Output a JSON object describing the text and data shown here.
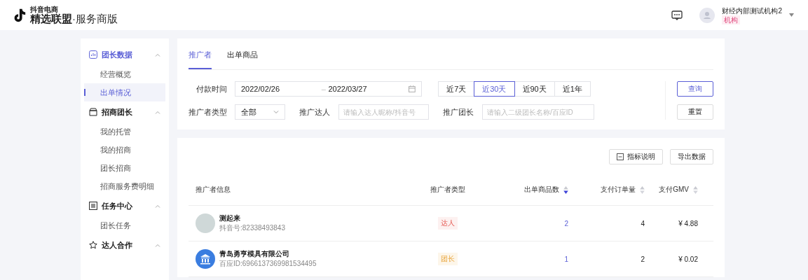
{
  "header": {
    "brand_small": "抖音电商",
    "brand_main": "精选联盟",
    "brand_sub": "·服务商版",
    "user_name": "财经内部测试机构2",
    "user_role": "机构"
  },
  "sidebar": {
    "groups": [
      {
        "title": "团长数据",
        "expanded": true,
        "selected": true,
        "children": [
          {
            "label": "经营概览",
            "selected": false
          },
          {
            "label": "出单情况",
            "selected": true
          }
        ]
      },
      {
        "title": "招商团长",
        "expanded": true,
        "selected": false,
        "children": [
          {
            "label": "我的托管",
            "selected": false
          },
          {
            "label": "我的招商",
            "selected": false
          },
          {
            "label": "团长招商",
            "selected": false
          },
          {
            "label": "招商服务费明细",
            "selected": false
          }
        ]
      },
      {
        "title": "任务中心",
        "expanded": true,
        "selected": false,
        "children": [
          {
            "label": "团长任务",
            "selected": false
          }
        ]
      },
      {
        "title": "达人合作",
        "expanded": true,
        "selected": false
      }
    ]
  },
  "tabs": [
    {
      "label": "推广者",
      "selected": true
    },
    {
      "label": "出单商品",
      "selected": false
    }
  ],
  "filters": {
    "date_label": "付款时间",
    "date_start": "2022/02/26",
    "date_sep": "–",
    "date_end": "2022/03/27",
    "ranges": [
      {
        "label": "近7天",
        "selected": false
      },
      {
        "label": "近30天",
        "selected": true
      },
      {
        "label": "近90天",
        "selected": false
      },
      {
        "label": "近1年",
        "selected": false
      }
    ],
    "type_label": "推广者类型",
    "type_value": "全部",
    "talent_label": "推广达人",
    "talent_placeholder": "请输入达人昵称/抖音号",
    "leader_label": "推广团长",
    "leader_placeholder": "请输入二级团长名称/百应ID",
    "query_button": "查询",
    "reset_button": "重置"
  },
  "actions": [
    {
      "label": "指标说明"
    },
    {
      "label": "导出数据"
    }
  ],
  "table": {
    "columns": [
      {
        "label": "推广者信息",
        "sortable": false
      },
      {
        "label": "推广者类型",
        "sortable": false
      },
      {
        "label": "出单商品数",
        "sortable": true,
        "sorted": true
      },
      {
        "label": "支付订单量",
        "sortable": true,
        "sorted": false
      },
      {
        "label": "支付GMV",
        "sortable": true,
        "sorted": false
      }
    ],
    "rows": [
      {
        "name": "测起来",
        "id": "抖音号:82338493843",
        "kind": "talent",
        "type": "达人",
        "items": "2",
        "orders": "4",
        "gmv": "¥ 4.88"
      },
      {
        "name": "青岛勇亨模具有限公司",
        "id": "百应ID:6966137369981534495",
        "kind": "leader",
        "type": "团长",
        "items": "1",
        "orders": "2",
        "gmv": "¥ 0.02"
      }
    ]
  }
}
